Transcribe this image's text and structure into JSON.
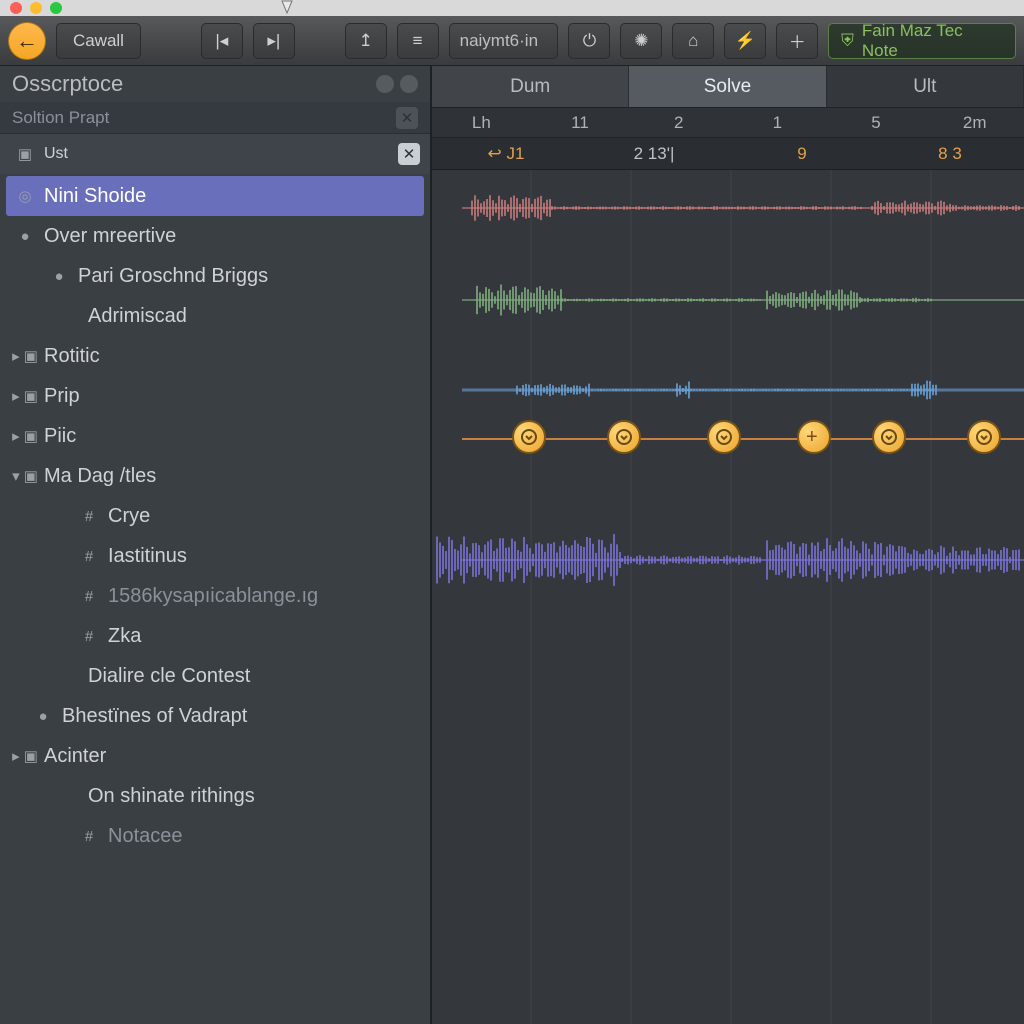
{
  "toolbar": {
    "back_label": "←",
    "title": "Cawall",
    "search_placeholder": "naiymt6·in",
    "right_chip": "Fain Maz Tec Note"
  },
  "sidebar": {
    "panel_title": "Osscrptoce",
    "sub_title": "Soltion Prapt",
    "pinned": {
      "label": "Ust"
    },
    "tree": [
      {
        "kind": "sel",
        "icon": "◎",
        "label": "Nini Shoide"
      },
      {
        "kind": "bullet",
        "icon": "●",
        "label": "Over mreertive"
      },
      {
        "kind": "bullet",
        "icon": "●",
        "label": "Pari Groschnd Briggs",
        "indent": 1
      },
      {
        "kind": "plain",
        "icon": "",
        "label": "Adrimiscad",
        "indent": 1
      },
      {
        "kind": "folder",
        "icon": "▸",
        "label": "Rotitic"
      },
      {
        "kind": "folder",
        "icon": "▸",
        "label": "Prip"
      },
      {
        "kind": "folder",
        "icon": "▸",
        "label": "Piic"
      },
      {
        "kind": "folder-open",
        "icon": "▾",
        "label": "Ma Dag /tles"
      },
      {
        "kind": "hash",
        "icon": "#",
        "label": "Crye",
        "indent": 2
      },
      {
        "kind": "hash",
        "icon": "#",
        "label": "Iastitinus",
        "indent": 2
      },
      {
        "kind": "hash",
        "icon": "#",
        "label": "1586kysapıicablange.ıg",
        "indent": 2,
        "dim": true
      },
      {
        "kind": "hash",
        "icon": "#",
        "label": "Zka",
        "indent": 2
      },
      {
        "kind": "plain",
        "icon": "",
        "label": "Dialire cle Contest",
        "indent": 1
      },
      {
        "kind": "bullet",
        "icon": "●",
        "label": "Bhestïnes of Vadrapt",
        "indent": 0
      },
      {
        "kind": "folder",
        "icon": "▸",
        "label": "Acinter"
      },
      {
        "kind": "plain",
        "icon": "",
        "label": "On shinate rithings",
        "indent": 1
      },
      {
        "kind": "hash",
        "icon": "#",
        "label": "Notacee",
        "indent": 2,
        "dim": true
      }
    ]
  },
  "editor": {
    "tabs": [
      {
        "label": "Dum",
        "active": false
      },
      {
        "label": "Solve",
        "active": true
      },
      {
        "label": "Ult",
        "active": false,
        "dark": true
      }
    ],
    "ruler": [
      "Lh",
      "11",
      "2",
      "1",
      "5",
      "2m"
    ],
    "secline": [
      {
        "t": "↩ J1",
        "cls": "amber"
      },
      {
        "t": "2 13'|",
        "cls": ""
      },
      {
        "t": "9",
        "cls": "amber"
      },
      {
        "t": "8 3",
        "cls": "amber"
      }
    ],
    "markers_x": [
      80,
      175,
      275,
      365,
      440,
      535
    ]
  },
  "colors": {
    "track1": "#c77b7b",
    "track2": "#7fae7f",
    "track3": "#6aa1d8",
    "track4": "#7a72d8"
  }
}
